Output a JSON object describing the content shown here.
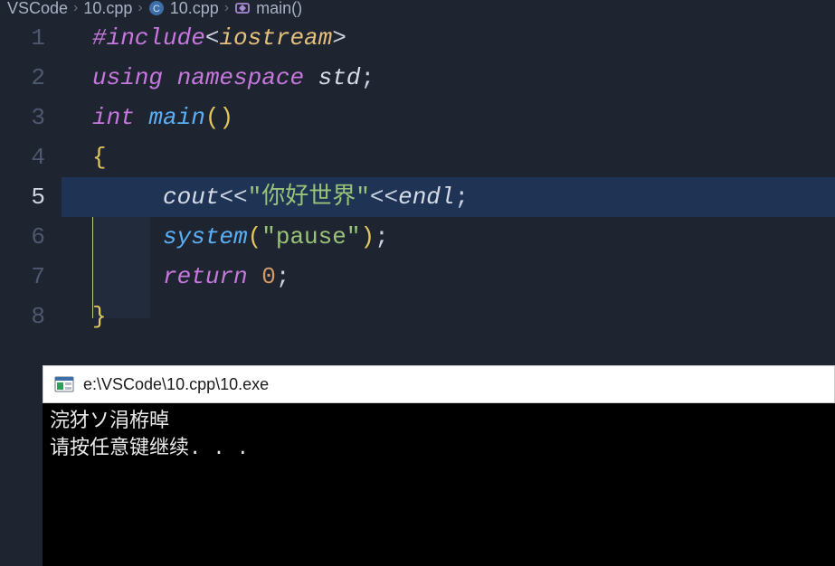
{
  "breadcrumb": {
    "items": [
      "VSCode",
      "10.cpp",
      "10.cpp",
      "main()"
    ]
  },
  "gutter": {
    "lines": [
      "1",
      "2",
      "3",
      "4",
      "5",
      "6",
      "7",
      "8"
    ],
    "active": 5
  },
  "code": {
    "l1": {
      "include": "#include",
      "lt": "<",
      "hdr": "iostream",
      "gt": ">"
    },
    "l2": {
      "using": "using",
      "namespace": "namespace",
      "std": "std",
      "semi": ";"
    },
    "l3": {
      "int": "int",
      "main": "main",
      "lp": "(",
      "rp": ")"
    },
    "l4": {
      "brace": "{"
    },
    "l5": {
      "cout": "cout",
      "ll1": "<<",
      "str": "\"你好世界\"",
      "ll2": "<<",
      "endl": "endl",
      "semi": ";"
    },
    "l6": {
      "system": "system",
      "lp": "(",
      "str": "\"pause\"",
      "rp": ")",
      "semi": ";"
    },
    "l7": {
      "return": "return",
      "zero": "0",
      "semi": ";"
    },
    "l8": {
      "brace": "}"
    }
  },
  "terminal": {
    "title": "e:\\VSCode\\10.cpp\\10.exe",
    "out1": "浣犲ソ涓栫晫",
    "out2": "请按任意键继续. . ."
  }
}
